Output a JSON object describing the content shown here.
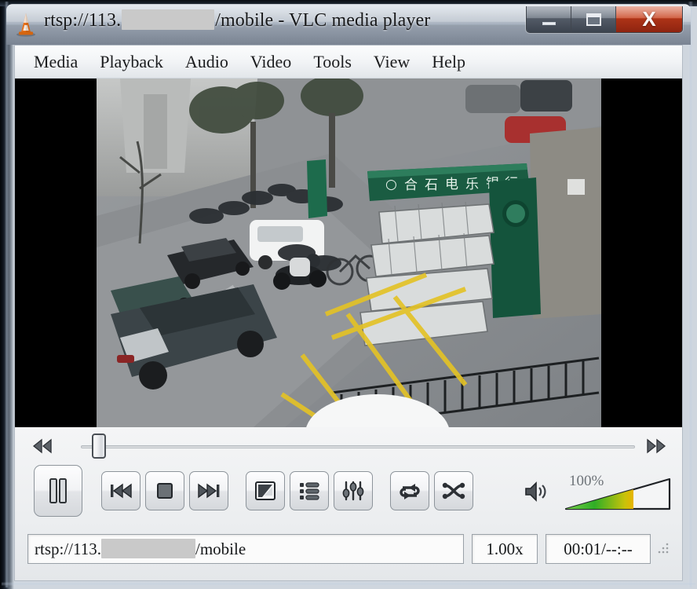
{
  "window": {
    "title_prefix": "rtsp://113.",
    "title_redacted": true,
    "title_suffix": "/mobile - VLC media player",
    "app_icon": "vlc-cone-icon",
    "controls": {
      "minimize_label": "",
      "restore_label": "",
      "close_label": "X",
      "close_color": "#b33317"
    }
  },
  "menubar": {
    "items": [
      {
        "label": "Media"
      },
      {
        "label": "Playback"
      },
      {
        "label": "Audio"
      },
      {
        "label": "Video"
      },
      {
        "label": "Tools"
      },
      {
        "label": "View"
      },
      {
        "label": "Help"
      }
    ]
  },
  "video": {
    "description": "Overhead CCTV view of an urban street with parked cars, scooters, a white van, a green storefront sign with Chinese characters, and yellow road markings",
    "pillarbox_color": "#000000",
    "sign_text": "合石电乐银行"
  },
  "seekbar": {
    "position_percent": 0,
    "prev_icon": "rewind-icon",
    "next_icon": "fastforward-icon"
  },
  "transport": {
    "play_pause": {
      "name": "pause-button",
      "state": "pause"
    },
    "previous": {
      "name": "previous-button"
    },
    "stop": {
      "name": "stop-button"
    },
    "next": {
      "name": "next-button"
    },
    "fullscreen": {
      "name": "fullscreen-button"
    },
    "playlist": {
      "name": "playlist-button"
    },
    "extended": {
      "name": "extended-settings-button"
    },
    "loop": {
      "name": "loop-button"
    },
    "shuffle": {
      "name": "shuffle-button"
    }
  },
  "volume": {
    "label": "100%",
    "level_percent": 65,
    "icon": "speaker-icon",
    "fill_start_color": "#1fa01f",
    "fill_end_color": "#e8b400"
  },
  "status": {
    "url_prefix": "rtsp://113.",
    "url_redacted": true,
    "url_suffix": "/mobile",
    "speed": "1.00x",
    "time": "00:01/--:--"
  }
}
